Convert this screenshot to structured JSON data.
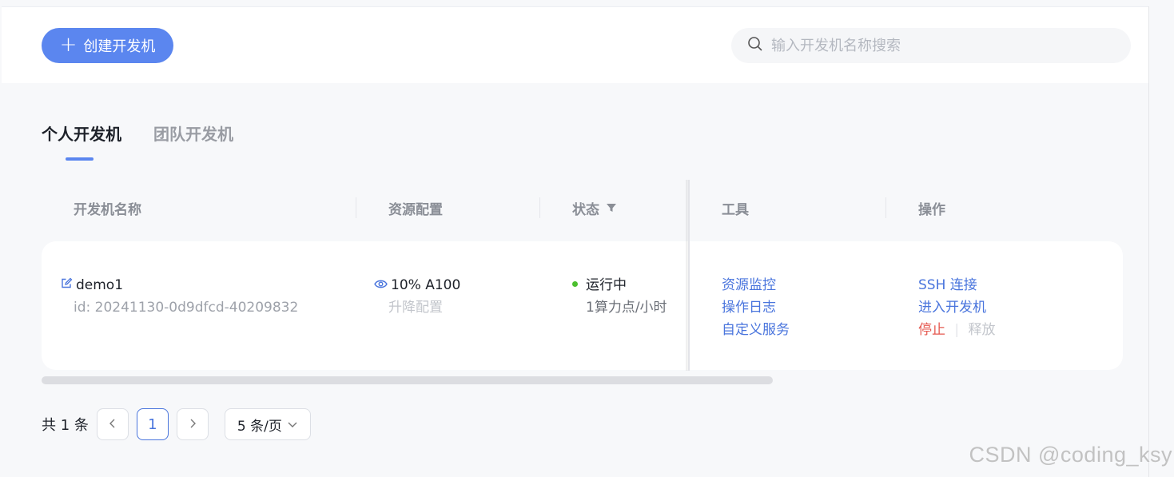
{
  "toolbar": {
    "create_label": "创建开发机",
    "search_placeholder": "输入开发机名称搜索"
  },
  "tabs": [
    {
      "label": "个人开发机",
      "active": true
    },
    {
      "label": "团队开发机",
      "active": false
    }
  ],
  "table": {
    "columns": [
      "开发机名称",
      "资源配置",
      "状态",
      "工具",
      "操作"
    ],
    "rows": [
      {
        "name": "demo1",
        "id": "id: 20241130-0d9dfcd-40209832",
        "resource": "10% A100",
        "resource_action": "升降配置",
        "status": "运行中",
        "status_color": "#4bbf2e",
        "cost": "1算力点/小时",
        "tools": [
          "资源监控",
          "操作日志",
          "自定义服务"
        ],
        "actions": {
          "ssh": "SSH 连接",
          "enter": "进入开发机",
          "stop": "停止",
          "release": "释放"
        }
      }
    ]
  },
  "pagination": {
    "total": "共 1 条",
    "current_page": "1",
    "page_size": "5 条/页"
  },
  "watermark": "CSDN @coding_ksy",
  "colors": {
    "primary": "#5b86ef",
    "link": "#4a75dd",
    "danger": "#e5584f"
  }
}
